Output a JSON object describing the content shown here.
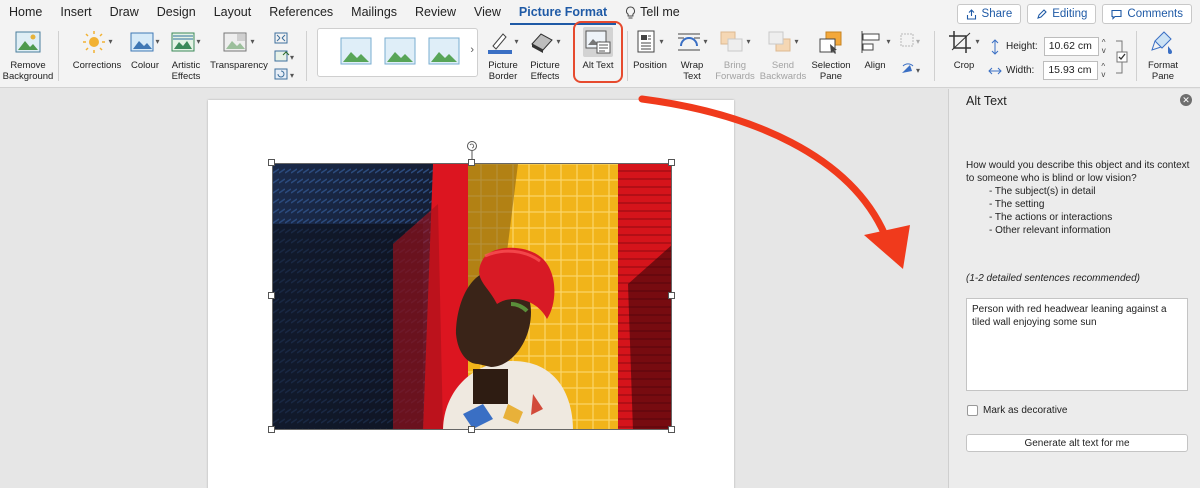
{
  "menu": {
    "tabs": [
      "Home",
      "Insert",
      "Draw",
      "Design",
      "Layout",
      "References",
      "Mailings",
      "Review",
      "View",
      "Picture Format"
    ],
    "active_tab": "Picture Format",
    "tell_me": "Tell me"
  },
  "top_buttons": {
    "share": "Share",
    "editing": "Editing",
    "comments": "Comments"
  },
  "ribbon": {
    "remove_background": "Remove Background",
    "corrections": "Corrections",
    "colour": "Colour",
    "artistic_effects": "Artistic Effects",
    "transparency": "Transparency",
    "picture_border": "Picture Border",
    "picture_effects": "Picture Effects",
    "alt_text": "Alt Text",
    "position": "Position",
    "wrap_text": "Wrap Text",
    "bring_forwards": "Bring Forwards",
    "send_backwards": "Send Backwards",
    "selection_pane": "Selection Pane",
    "align": "Align",
    "crop": "Crop",
    "height_label": "Height:",
    "height_value": "10.62 cm",
    "width_label": "Width:",
    "width_value": "15.93 cm",
    "format_pane": "Format Pane"
  },
  "alt_text_pane": {
    "title": "Alt Text",
    "question": "How would you describe this object and its context to someone who is blind or low vision?",
    "bullets": [
      "- The subject(s) in detail",
      "- The setting",
      "- The actions or interactions",
      "- Other relevant information"
    ],
    "recommendation": "(1-2 detailed sentences recommended)",
    "alt_text_value": "Person with red headwear leaning against a tiled wall enjoying some sun",
    "mark_decorative": "Mark as decorative",
    "generate_button": "Generate alt text for me"
  },
  "colors": {
    "accent": "#1f5aa6",
    "highlight": "#e64a2e",
    "arrow": "#f03a1c"
  }
}
